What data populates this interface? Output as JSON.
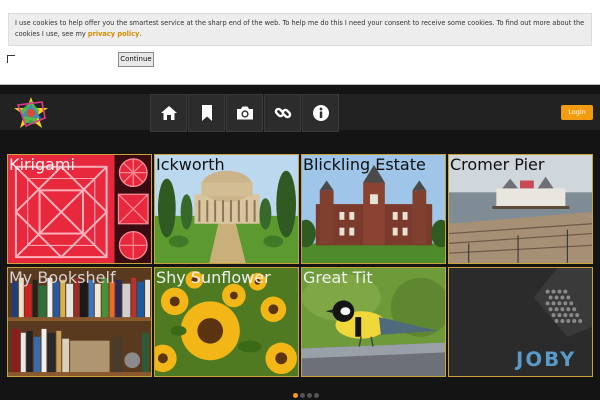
{
  "cookie_banner": {
    "message": "I use cookies to help offer you the smartest service at the sharp end of the web. To help me do this I need your consent to receive some cookies. To find out more about the cookies I use, see my ",
    "link_text": "privacy policy",
    "suffix": ".",
    "continue_label": "Continue"
  },
  "header": {
    "nav_icons": [
      "home-icon",
      "bookmark-icon",
      "camera-icon",
      "link-icon",
      "info-icon"
    ],
    "login_label": "Login",
    "accent_color": "#f39c12"
  },
  "tiles": [
    {
      "label": "Kirigami"
    },
    {
      "label": "Ickworth"
    },
    {
      "label": "Blickling Estate"
    },
    {
      "label": "Cromer Pier"
    },
    {
      "label": "My Bookshelf"
    },
    {
      "label": "Shy Sunflower"
    },
    {
      "label": "Great Tit"
    },
    {
      "label": ""
    }
  ],
  "joby_text": "JOBY",
  "pagination": {
    "total": 4,
    "active": 1
  }
}
